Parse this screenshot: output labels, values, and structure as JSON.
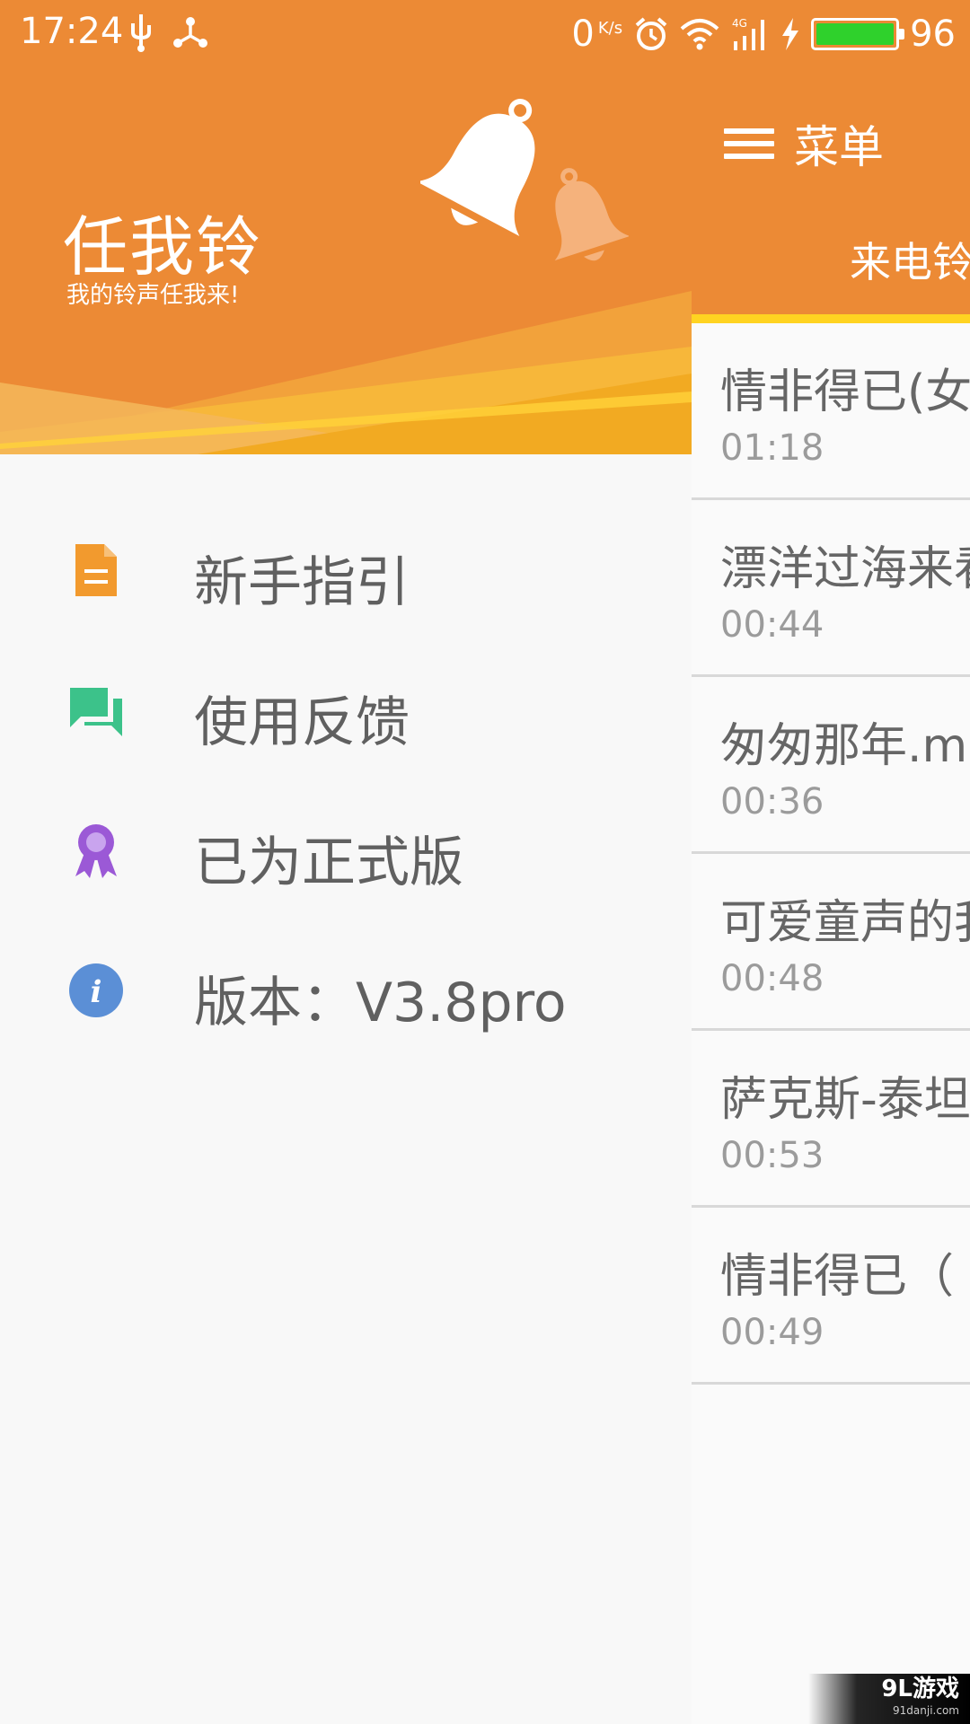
{
  "status_bar": {
    "time": "17:24",
    "net_speed_value": "0",
    "net_speed_unit": "K/s",
    "battery_level": "96",
    "battery_fill_fraction": 0.96,
    "icons": [
      "usb-icon",
      "share-icon",
      "alarm-icon",
      "wifi-icon",
      "signal-4g-icon",
      "charging-icon",
      "battery-icon"
    ]
  },
  "drawer": {
    "app_name": "任我铃",
    "slogan": "我的铃声任我来!",
    "items": [
      {
        "label": "新手指引",
        "icon": "document-icon",
        "color": "#f29a2e"
      },
      {
        "label": "使用反馈",
        "icon": "feedback-icon",
        "color": "#3cc28a"
      },
      {
        "label": "已为正式版",
        "icon": "award-icon",
        "color": "#9b59d6"
      },
      {
        "label": "版本：V3.8pro",
        "icon": "info-icon",
        "color": "#5b8fd6"
      }
    ]
  },
  "main": {
    "menu_label": "菜单",
    "tab_first": "来电铃",
    "tab_indicator_color": "#ffd321",
    "songs": [
      {
        "title": "情非得已(女",
        "duration": "01:18"
      },
      {
        "title": "漂洋过海来看",
        "duration": "00:44"
      },
      {
        "title": "匆匆那年.m",
        "duration": "00:36"
      },
      {
        "title": "可爱童声的我",
        "duration": "00:48"
      },
      {
        "title": "萨克斯-泰坦",
        "duration": "00:53"
      },
      {
        "title": "情非得已（",
        "duration": "00:49"
      }
    ]
  },
  "watermark": {
    "main": "9L游戏",
    "sub": "91danji.com"
  },
  "colors": {
    "primary": "#ec8a35",
    "accent": "#ffd321"
  }
}
